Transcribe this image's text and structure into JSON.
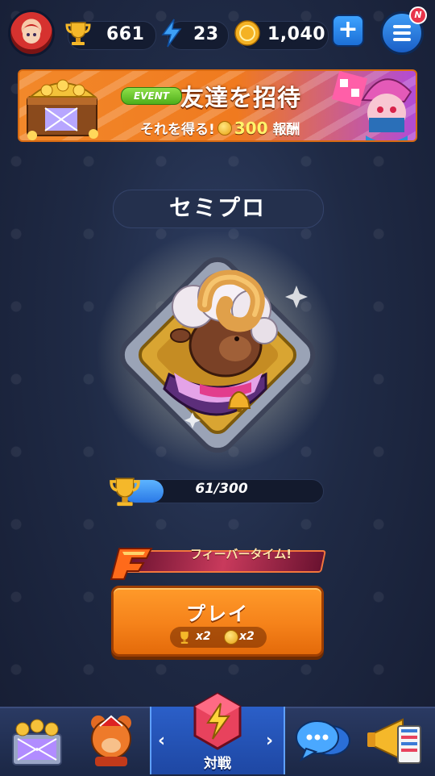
{
  "header": {
    "trophies": "661",
    "energy": "23",
    "coins": "1,040",
    "new_badge": "N",
    "add_button_glyph": "+"
  },
  "banner": {
    "tag": "EVENT",
    "title": "友達を招待",
    "subtitle_prefix": "それを得る!",
    "reward_amount": "300",
    "reward_suffix": "報酬"
  },
  "rank": {
    "title": "セミプロ",
    "progress_text": "61/300",
    "progress_fraction": 0.2033
  },
  "fever": {
    "label": "フィーバータイム!"
  },
  "play": {
    "label": "プレイ",
    "trophy_multiplier": "x2",
    "coin_multiplier": "x2"
  },
  "nav": {
    "battle_label": "対戦"
  },
  "colors": {
    "accent_blue": "#2a79e6",
    "play_orange": "#f5821a",
    "banner_orange": "#f07a1f"
  }
}
